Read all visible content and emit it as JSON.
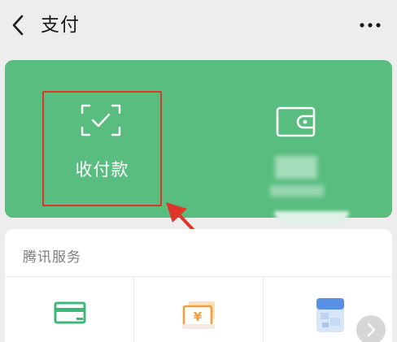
{
  "header": {
    "title": "支付",
    "back_icon": "chevron-left-icon",
    "more_icon": "more-dots-icon"
  },
  "pay_card": {
    "color": "#58bd7f",
    "receive_pay": {
      "label": "收付款",
      "icon": "scan-check-icon"
    },
    "wallet": {
      "icon": "wallet-icon"
    }
  },
  "annotation": {
    "color": "#e0352b"
  },
  "services": {
    "title": "腾讯服务",
    "items": [
      {
        "icon": "credit-card-icon",
        "color": "#3cb878"
      },
      {
        "icon": "yuan-money-icon",
        "color": "#f0a03a"
      },
      {
        "icon": "id-card-icon",
        "color": "#5a8fe6"
      }
    ]
  }
}
